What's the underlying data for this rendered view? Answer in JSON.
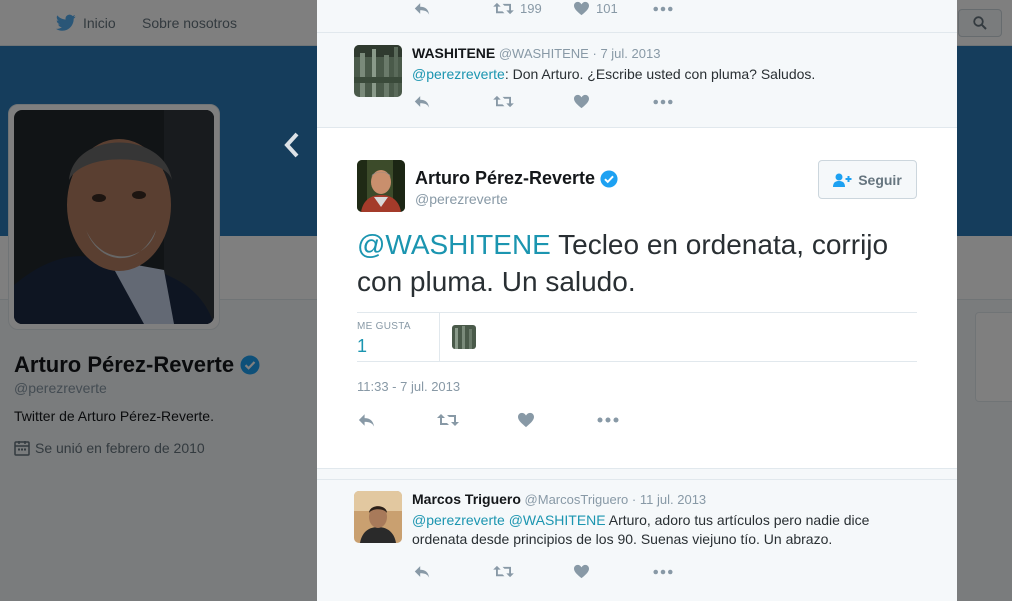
{
  "topbar": {
    "home_label": "Inicio",
    "about_label": "Sobre nosotros"
  },
  "profile": {
    "name": "Arturo Pérez-Reverte",
    "handle": "@perezreverte",
    "bio": "Twitter de Arturo Pérez-Reverte.",
    "joined": "Se unió en febrero de 2010"
  },
  "modal": {
    "prev_tweet_actions": {
      "retweets": "199",
      "likes": "101"
    },
    "reply_tweet": {
      "name": "WASHITENE",
      "handle": "@WASHITENE",
      "sep": "·",
      "date": "7 jul. 2013",
      "mention": "@perezreverte",
      "text": ": Don Arturo. ¿Escribe usted con pluma? Saludos."
    },
    "main_tweet": {
      "name": "Arturo Pérez-Reverte",
      "handle": "@perezreverte",
      "follow_label": "Seguir",
      "mention": "@WASHITENE",
      "text": " Tecleo en ordenata, corrijo con pluma. Un saludo.",
      "likes_label": "ME GUSTA",
      "likes_count": "1",
      "timestamp": "11:33 - 7 jul. 2013"
    },
    "next_tweet": {
      "name": "Marcos Triguero",
      "handle": "@MarcosTriguero",
      "sep": "·",
      "date": "11 jul. 2013",
      "mention1": "@perezreverte",
      "mention2": "@WASHITENE",
      "text": "  Arturo, adoro tus artículos pero nadie dice ordenata desde principios de los 90. Suenas viejuno tío. Un abrazo."
    }
  },
  "colors": {
    "banner": "#2b7bb9",
    "link": "#1b95b0",
    "verified": "#1da1f2",
    "twitter_blue": "#55acee"
  },
  "icons": [
    "twitter-bird-icon",
    "search-icon",
    "chevron-left-icon",
    "reply-icon",
    "retweet-icon",
    "heart-icon",
    "more-icon",
    "verified-icon",
    "calendar-icon",
    "add-user-icon"
  ]
}
